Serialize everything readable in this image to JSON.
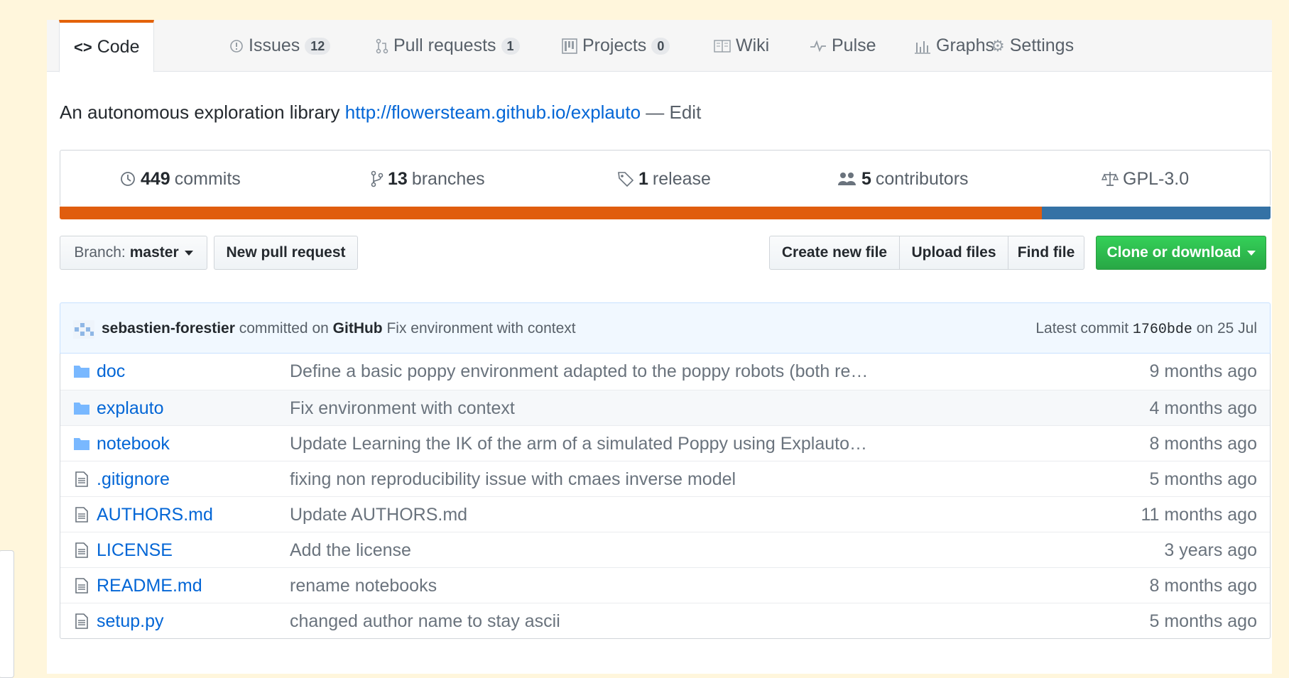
{
  "tabs": [
    {
      "label": "Code",
      "count": null,
      "icon": "code-icon"
    },
    {
      "label": "Issues",
      "count": "12",
      "icon": "issue-icon"
    },
    {
      "label": "Pull requests",
      "count": "1",
      "icon": "pull-request-icon"
    },
    {
      "label": "Projects",
      "count": "0",
      "icon": "project-icon"
    },
    {
      "label": "Wiki",
      "count": null,
      "icon": "book-icon"
    },
    {
      "label": "Pulse",
      "count": null,
      "icon": "pulse-icon"
    },
    {
      "label": "Graphs",
      "count": null,
      "icon": "graph-icon"
    },
    {
      "label": "Settings",
      "count": null,
      "icon": "gear-icon"
    }
  ],
  "description": {
    "text": "An autonomous exploration library",
    "url": "http://flowersteam.github.io/explauto",
    "edit": "— Edit"
  },
  "summary": {
    "commits": {
      "count": "449",
      "label": "commits"
    },
    "branches": {
      "count": "13",
      "label": "branches"
    },
    "releases": {
      "count": "1",
      "label": "release"
    },
    "contributors": {
      "count": "5",
      "label": "contributors"
    },
    "license": "GPL-3.0"
  },
  "languages": [
    {
      "color": "#e05d0e",
      "percent": 81.1
    },
    {
      "color": "#3572a5",
      "percent": 18.9
    }
  ],
  "branch": {
    "label": "Branch:",
    "name": "master"
  },
  "buttons": {
    "new_pull_request": "New pull request",
    "create_new_file": "Create new file",
    "upload_files": "Upload files",
    "find_file": "Find file",
    "clone_or_download": "Clone or download"
  },
  "commit": {
    "author": "sebastien-forestier",
    "committed_on": "committed on",
    "platform": "GitHub",
    "message": "Fix environment with context",
    "latest_label": "Latest commit",
    "sha": "1760bde",
    "date": "on 25 Jul"
  },
  "files": [
    {
      "type": "dir",
      "name": "doc",
      "message": "Define a basic poppy environment adapted to the poppy robots (both re…",
      "age": "9 months ago"
    },
    {
      "type": "dir",
      "name": "explauto",
      "message": "Fix environment with context",
      "age": "4 months ago"
    },
    {
      "type": "dir",
      "name": "notebook",
      "message": "Update Learning the IK of the arm of a simulated Poppy using Explauto…",
      "age": "8 months ago"
    },
    {
      "type": "file",
      "name": ".gitignore",
      "message": "fixing non reproducibility issue with cmaes inverse model",
      "age": "5 months ago"
    },
    {
      "type": "file",
      "name": "AUTHORS.md",
      "message": "Update AUTHORS.md",
      "age": "11 months ago"
    },
    {
      "type": "file",
      "name": "LICENSE",
      "message": "Add the license",
      "age": "3 years ago"
    },
    {
      "type": "file",
      "name": "README.md",
      "message": "rename notebooks",
      "age": "8 months ago"
    },
    {
      "type": "file",
      "name": "setup.py",
      "message": "changed author name to stay ascii",
      "age": "5 months ago"
    }
  ]
}
